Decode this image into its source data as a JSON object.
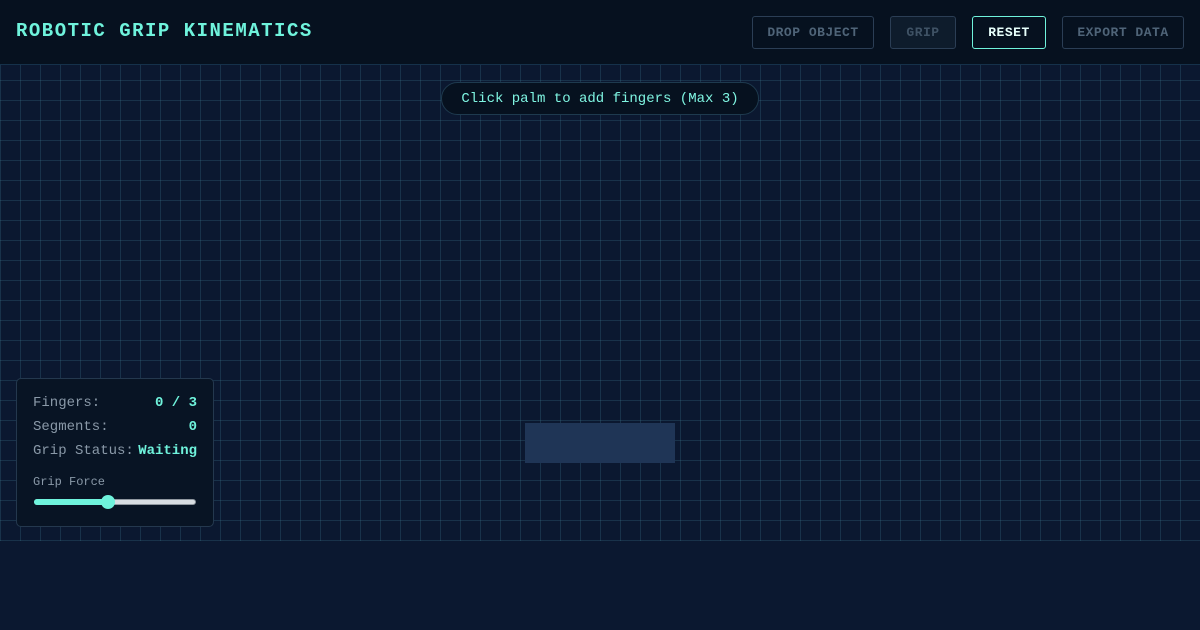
{
  "header": {
    "title": "ROBOTIC GRIP KINEMATICS",
    "buttons": {
      "drop_object": "DROP OBJECT",
      "grip": "GRIP",
      "reset": "RESET",
      "export_data": "EXPORT DATA"
    }
  },
  "workspace": {
    "hint": "Click palm to add fingers (Max 3)"
  },
  "stats": {
    "fingers_label": "Fingers:",
    "fingers_value": "0 / 3",
    "segments_label": "Segments:",
    "segments_value": "0",
    "status_label": "Grip Status:",
    "status_value": "Waiting",
    "force_label": "Grip Force",
    "force_level": 0.45
  },
  "colors": {
    "accent": "#6ff3dc",
    "background": "#0b1830",
    "header_bg": "#06111f",
    "palm": "#1f3556"
  }
}
